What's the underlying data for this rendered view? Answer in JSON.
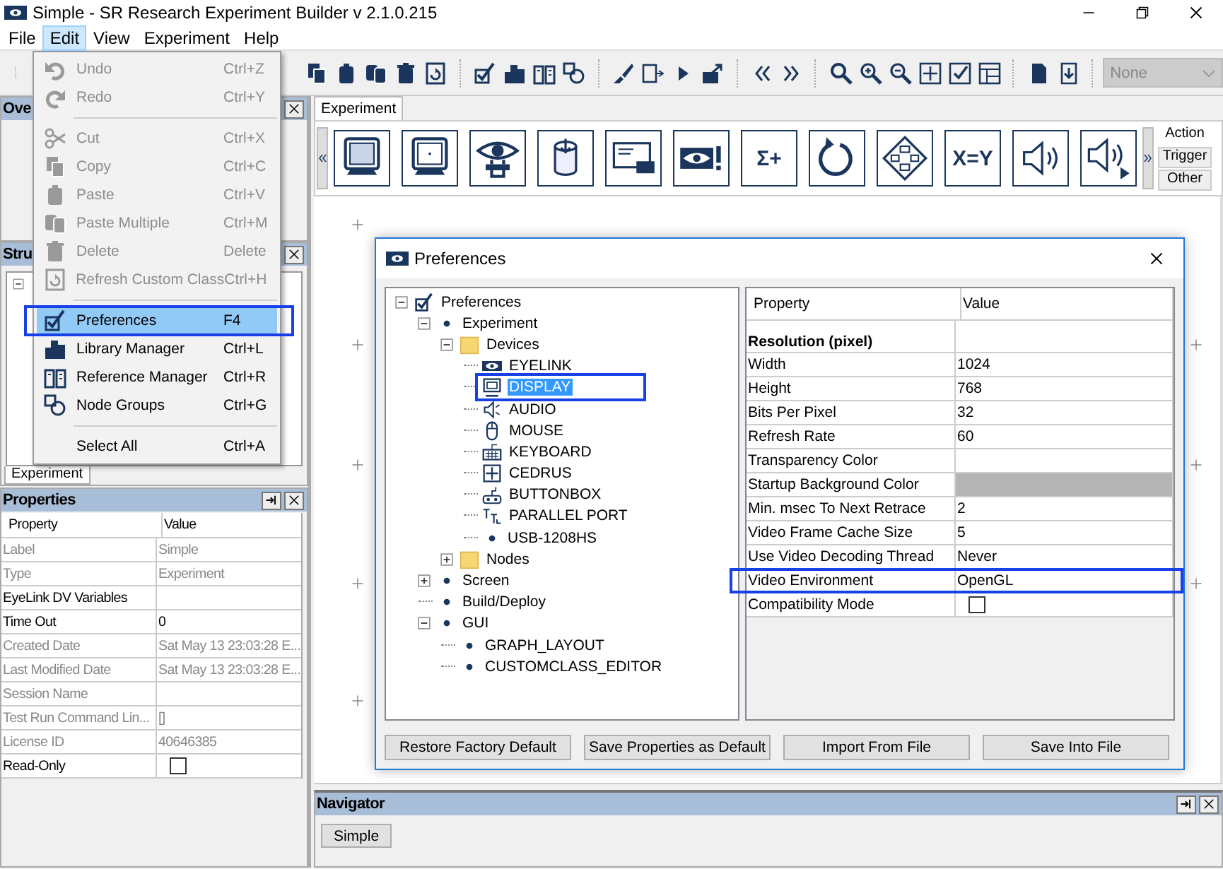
{
  "window": {
    "title": "Simple - SR Research Experiment Builder v 2.1.0.215"
  },
  "menu_bar": [
    {
      "label": "File",
      "selected": false
    },
    {
      "label": "Edit",
      "selected": true
    },
    {
      "label": "View",
      "selected": false
    },
    {
      "label": "Experiment",
      "selected": false
    },
    {
      "label": "Help",
      "selected": false
    }
  ],
  "edit_menu": {
    "items": [
      {
        "kind": "undo",
        "label": "Undo",
        "shortcut": "Ctrl+Z",
        "disabled": true,
        "selected": false,
        "outlined": false
      },
      {
        "kind": "redo",
        "label": "Redo",
        "shortcut": "Ctrl+Y",
        "disabled": true,
        "selected": false,
        "outlined": false
      },
      {
        "kind": "separator"
      },
      {
        "kind": "cut",
        "label": "Cut",
        "shortcut": "Ctrl+X",
        "disabled": true,
        "selected": false,
        "outlined": false
      },
      {
        "kind": "copy",
        "label": "Copy",
        "shortcut": "Ctrl+C",
        "disabled": true,
        "selected": false,
        "outlined": false
      },
      {
        "kind": "paste",
        "label": "Paste",
        "shortcut": "Ctrl+V",
        "disabled": true,
        "selected": false,
        "outlined": false
      },
      {
        "kind": "pastem",
        "label": "Paste Multiple",
        "shortcut": "Ctrl+M",
        "disabled": true,
        "selected": false,
        "outlined": false
      },
      {
        "kind": "delete",
        "label": "Delete",
        "shortcut": "Delete",
        "disabled": true,
        "selected": false,
        "outlined": false
      },
      {
        "kind": "refresh",
        "label": "Refresh Custom Class",
        "shortcut": "Ctrl+H",
        "disabled": true,
        "selected": false,
        "outlined": false
      },
      {
        "kind": "separator"
      },
      {
        "kind": "prefs",
        "label": "Preferences",
        "shortcut": "F4",
        "disabled": false,
        "selected": true,
        "outlined": true
      },
      {
        "kind": "library",
        "label": "Library Manager",
        "shortcut": "Ctrl+L",
        "disabled": false,
        "selected": false,
        "outlined": false
      },
      {
        "kind": "reference",
        "label": "Reference Manager",
        "shortcut": "Ctrl+R",
        "disabled": false,
        "selected": false,
        "outlined": false
      },
      {
        "kind": "nodegroups",
        "label": "Node Groups",
        "shortcut": "Ctrl+G",
        "disabled": false,
        "selected": false,
        "outlined": false
      },
      {
        "kind": "separator"
      },
      {
        "kind": "none",
        "label": "Select All",
        "shortcut": "Ctrl+A",
        "disabled": false,
        "selected": false,
        "outlined": false
      }
    ]
  },
  "toolbar": {
    "view_select": {
      "value": "None",
      "disabled": true
    }
  },
  "overview_panel": {
    "title": "Ove"
  },
  "structure_panel": {
    "title": "Stru",
    "tabs": [
      {
        "label": "Experiment",
        "selected": true
      }
    ]
  },
  "properties": {
    "title": "Properties",
    "columns": [
      "Property",
      "Value"
    ],
    "rows": [
      {
        "kind": "text",
        "label": "Label",
        "value": "Simple",
        "disabled": true
      },
      {
        "kind": "text",
        "label": "Type",
        "value": "Experiment",
        "disabled": true
      },
      {
        "kind": "text",
        "label": "EyeLink DV Variables",
        "disabled": false
      },
      {
        "kind": "text",
        "label": "Time Out",
        "value": "0",
        "disabled": false
      },
      {
        "kind": "text",
        "label": "Created Date",
        "value": "Sat May 13 23:03:28 E...",
        "disabled": true
      },
      {
        "kind": "text",
        "label": "Last Modified Date",
        "value": "Sat May 13 23:03:28 E...",
        "disabled": true
      },
      {
        "kind": "text",
        "label": "Session Name",
        "disabled": true
      },
      {
        "kind": "text",
        "label": "Test Run Command Lin...",
        "value": "[]",
        "disabled": true
      },
      {
        "kind": "text",
        "label": "License ID",
        "value": "40646385",
        "disabled": true
      },
      {
        "kind": "checkbox",
        "label": "Read-Only",
        "checked": false,
        "disabled": false
      }
    ]
  },
  "editor": {
    "tabs": [
      {
        "label": "Experiment",
        "selected": true
      }
    ],
    "palette": {
      "tiles": [
        {
          "kind": "monitor"
        },
        {
          "kind": "monitor-dot"
        },
        {
          "kind": "eye"
        },
        {
          "kind": "cylinder"
        },
        {
          "kind": "envelope"
        },
        {
          "kind": "eye-alert"
        },
        {
          "kind": "text",
          "label": "Σ+"
        },
        {
          "kind": "loop"
        },
        {
          "kind": "diamond"
        },
        {
          "kind": "text",
          "label": "X=Y"
        },
        {
          "kind": "speaker"
        },
        {
          "kind": "speaker-play"
        }
      ],
      "categories": [
        {
          "label": "Action",
          "selected": true
        },
        {
          "label": "Trigger",
          "selected": false
        },
        {
          "label": "Other",
          "selected": false
        }
      ]
    }
  },
  "preferences_dialog": {
    "title": "Preferences",
    "tree": [
      {
        "kind": "check",
        "label": "Preferences",
        "expanded": true,
        "selected": false,
        "outlined": false,
        "children": [
          {
            "kind": "dot",
            "label": "Experiment",
            "expanded": true,
            "selected": false,
            "outlined": false,
            "children": [
              {
                "kind": "folder",
                "label": "Devices",
                "expanded": true,
                "selected": false,
                "outlined": false,
                "children": [
                  {
                    "kind": "eyelink",
                    "label": "EYELINK",
                    "selected": false,
                    "outlined": false
                  },
                  {
                    "kind": "display",
                    "label": "DISPLAY",
                    "selected": true,
                    "outlined": true
                  },
                  {
                    "kind": "audio",
                    "label": "AUDIO",
                    "selected": false,
                    "outlined": false
                  },
                  {
                    "kind": "mouse",
                    "label": "MOUSE",
                    "selected": false,
                    "outlined": false
                  },
                  {
                    "kind": "keyboard",
                    "label": "KEYBOARD",
                    "selected": false,
                    "outlined": false
                  },
                  {
                    "kind": "cedrus",
                    "label": "CEDRUS",
                    "selected": false,
                    "outlined": false
                  },
                  {
                    "kind": "buttonbox",
                    "label": "BUTTONBOX",
                    "selected": false,
                    "outlined": false
                  },
                  {
                    "kind": "ttl",
                    "label": "PARALLEL PORT",
                    "selected": false,
                    "outlined": false
                  },
                  {
                    "kind": "dot",
                    "label": "USB-1208HS",
                    "selected": false,
                    "outlined": false
                  }
                ]
              },
              {
                "kind": "folder",
                "label": "Nodes",
                "expanded": false,
                "selected": false,
                "outlined": false
              }
            ]
          },
          {
            "kind": "dot",
            "label": "Screen",
            "expanded": false,
            "selected": false,
            "outlined": false
          },
          {
            "kind": "dot",
            "label": "Build/Deploy",
            "selected": false,
            "outlined": false
          },
          {
            "kind": "dot",
            "label": "GUI",
            "expanded": true,
            "selected": false,
            "outlined": false,
            "children": [
              {
                "kind": "dot",
                "label": "GRAPH_LAYOUT",
                "selected": false,
                "outlined": false
              },
              {
                "kind": "dot",
                "label": "CUSTOMCLASS_EDITOR",
                "selected": false,
                "outlined": false
              }
            ]
          }
        ]
      }
    ],
    "table": {
      "columns": [
        "Property",
        "Value"
      ],
      "rows": [
        {
          "kind": "section",
          "label": "Resolution (pixel)",
          "outlined": false
        },
        {
          "kind": "text",
          "label": "Width",
          "value": "1024",
          "outlined": false
        },
        {
          "kind": "text",
          "label": "Height",
          "value": "768",
          "outlined": false
        },
        {
          "kind": "text",
          "label": "Bits Per Pixel",
          "value": "32",
          "outlined": false
        },
        {
          "kind": "text",
          "label": "Refresh Rate",
          "value": "60",
          "outlined": false
        },
        {
          "kind": "text",
          "label": "Transparency Color",
          "outlined": false
        },
        {
          "kind": "color",
          "label": "Startup Background Color",
          "color": "#b4b4b4",
          "outlined": false
        },
        {
          "kind": "text",
          "label": "Min. msec To Next Retrace",
          "value": "2",
          "outlined": false
        },
        {
          "kind": "text",
          "label": "Video Frame Cache Size",
          "value": "5",
          "outlined": false
        },
        {
          "kind": "text",
          "label": "Use Video Decoding Thread",
          "value": "Never",
          "outlined": false
        },
        {
          "kind": "text",
          "label": "Video Environment",
          "value": "OpenGL",
          "outlined": true
        },
        {
          "kind": "checkbox",
          "label": "Compatibility Mode",
          "checked": false,
          "outlined": false
        }
      ]
    },
    "buttons": [
      "Restore Factory Default",
      "Save Properties as Default",
      "Import From File",
      "Save Into File"
    ]
  },
  "navigator": {
    "title": "Navigator",
    "items": [
      "Simple"
    ]
  }
}
